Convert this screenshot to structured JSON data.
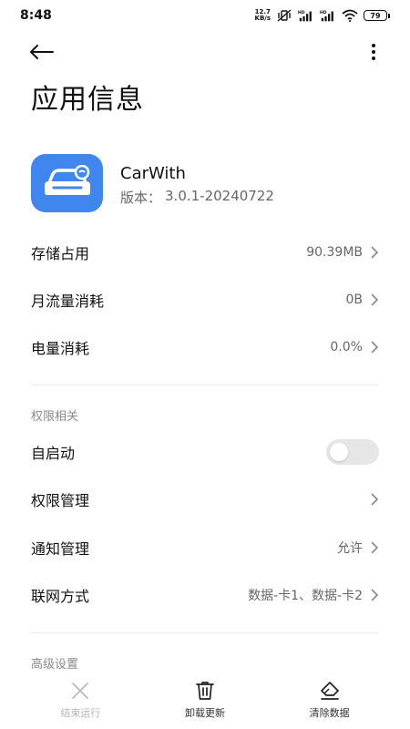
{
  "status_bar": {
    "time": "8:48",
    "net_speed_value": "12.7",
    "net_speed_unit": "KB/s",
    "battery": "79"
  },
  "page_title": "应用信息",
  "app": {
    "name": "CarWith",
    "version_label": "版本：",
    "version": "3.0.1-20240722",
    "icon_color": "#3f86ee"
  },
  "rows": {
    "storage": {
      "label": "存储占用",
      "value": "90.39MB"
    },
    "data_usage": {
      "label": "月流量消耗",
      "value": "0B"
    },
    "battery_usage": {
      "label": "电量消耗",
      "value": "0.0%"
    }
  },
  "permissions_section": {
    "header": "权限相关",
    "autostart": {
      "label": "自启动",
      "enabled": false
    },
    "permission_manage": {
      "label": "权限管理"
    },
    "notification": {
      "label": "通知管理",
      "value": "允许"
    },
    "network": {
      "label": "联网方式",
      "value": "数据-卡1、数据-卡2"
    }
  },
  "advanced_section": {
    "header": "高级设置"
  },
  "bottom_bar": {
    "force_stop": "结束运行",
    "uninstall_updates": "卸载更新",
    "clear_data": "清除数据"
  },
  "colors": {
    "accent": "#3f86ee",
    "toggle_off": "#e6e6e6",
    "secondary_text": "#666666"
  }
}
